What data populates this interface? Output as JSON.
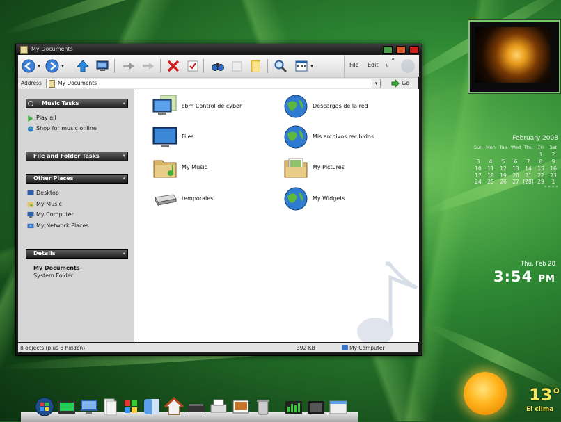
{
  "window": {
    "title": "My Documents",
    "menu": [
      "File",
      "Edit",
      "\\"
    ],
    "menu_more": "»"
  },
  "address": {
    "label": "Address",
    "value": "My Documents",
    "go_label": "Go"
  },
  "sidebar": {
    "music_tasks": {
      "title": "Music Tasks",
      "items": [
        "Play all",
        "Shop for music online"
      ]
    },
    "file_folder_tasks": {
      "title": "File and Folder Tasks"
    },
    "other_places": {
      "title": "Other Places",
      "items": [
        "Desktop",
        "My Music",
        "My Computer",
        "My Network Places"
      ]
    },
    "details": {
      "title": "Details",
      "name": "My Documents",
      "type": "System Folder"
    }
  },
  "items": [
    {
      "label": "cbm Control de cyber",
      "icon": "monitor-icon"
    },
    {
      "label": "Descargas de la red",
      "icon": "globe-icon"
    },
    {
      "label": "Files",
      "icon": "monitor-icon"
    },
    {
      "label": "Mis archivos recibidos",
      "icon": "globe-icon"
    },
    {
      "label": "My Music",
      "icon": "music-folder-icon"
    },
    {
      "label": "My Pictures",
      "icon": "pictures-folder-icon"
    },
    {
      "label": "temporales",
      "icon": "drive-icon"
    },
    {
      "label": "My Widgets",
      "icon": "globe-icon"
    }
  ],
  "status": {
    "objects": "8 objects (plus 8 hidden)",
    "size": "392 KB",
    "location": "My Computer"
  },
  "calendar": {
    "month": "February 2008",
    "days": [
      "Sun",
      "Mon",
      "Tue",
      "Wed",
      "Thu",
      "Fri",
      "Sat"
    ],
    "weeks": [
      [
        "",
        "",
        "",
        "",
        "",
        "1",
        "2"
      ],
      [
        "3",
        "4",
        "5",
        "6",
        "7",
        "8",
        "9"
      ],
      [
        "10",
        "11",
        "12",
        "13",
        "14",
        "15",
        "16"
      ],
      [
        "17",
        "18",
        "19",
        "20",
        "21",
        "22",
        "23"
      ],
      [
        "24",
        "25",
        "26",
        "27",
        "[28]",
        "29",
        "1"
      ]
    ],
    "footer": "« « » »"
  },
  "clock": {
    "date": "Thu, Feb 28",
    "time": "3:54",
    "ampm": "PM"
  },
  "weather": {
    "temp": "13°",
    "label": "El clima"
  },
  "colors": {
    "accent_green": "#3fae3a",
    "sidebar_bg": "#d6d6d6",
    "header_dark": "#1f1f1f"
  }
}
